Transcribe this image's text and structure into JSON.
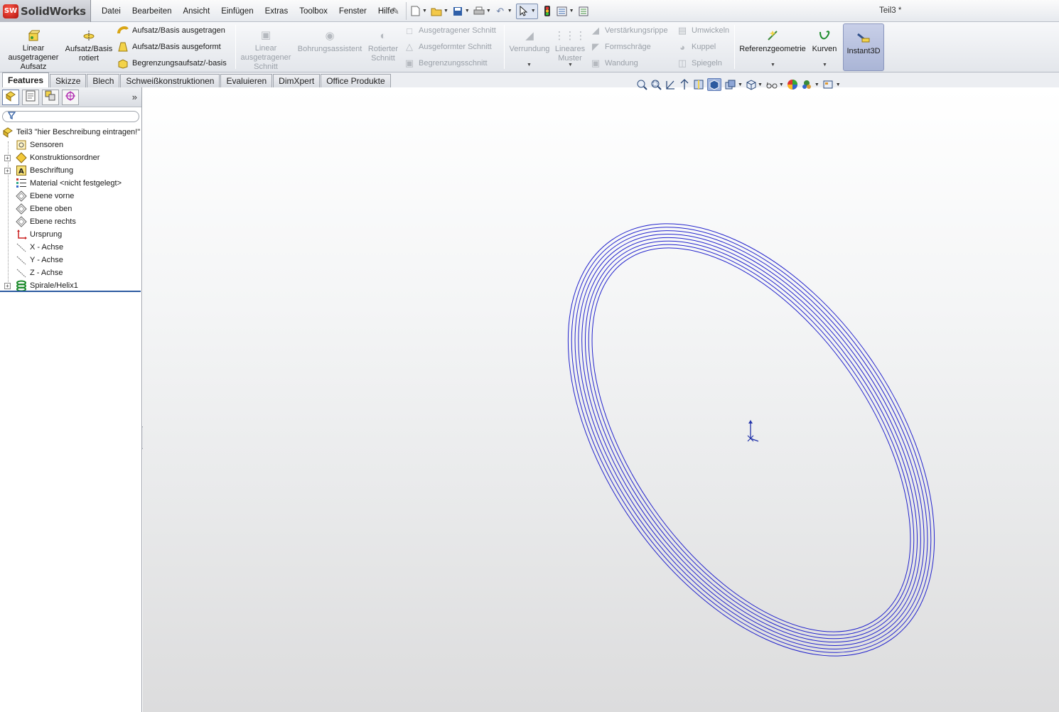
{
  "app": {
    "logo_badge": "SW",
    "name": "SolidWorks",
    "doc_title": "Teil3 *"
  },
  "menu": [
    "Datei",
    "Bearbeiten",
    "Ansicht",
    "Einfügen",
    "Extras",
    "Toolbox",
    "Fenster",
    "Hilfe"
  ],
  "commands": {
    "extrude_boss": "Linear ausgetragener Aufsatz",
    "revolve_boss": "Aufsatz/Basis rotiert",
    "sweep_boss": "Aufsatz/Basis ausgetragen",
    "loft_boss": "Aufsatz/Basis ausgeformt",
    "boundary_boss": "Begrenzungsaufsatz/-basis",
    "extrude_cut": "Linear ausgetragener Schnitt",
    "hole_wizard": "Bohrungsassistent",
    "revolve_cut": "Rotierter Schnitt",
    "sweep_cut": "Ausgetragener Schnitt",
    "loft_cut": "Ausgeformter Schnitt",
    "boundary_cut": "Begrenzungsschnitt",
    "fillet": "Verrundung",
    "linear_pattern": "Lineares Muster",
    "rib": "Verstärkungsrippe",
    "draft": "Formschräge",
    "shell": "Wandung",
    "wrap": "Umwickeln",
    "dome": "Kuppel",
    "mirror": "Spiegeln",
    "ref_geometry": "Referenzgeometrie",
    "curves": "Kurven",
    "instant3d": "Instant3D"
  },
  "tabs": [
    "Features",
    "Skizze",
    "Blech",
    "Schweißkonstruktionen",
    "Evaluieren",
    "DimXpert",
    "Office Produkte"
  ],
  "tree": {
    "root": "Teil3 \"hier Beschreibung eintragen!\"",
    "items": [
      {
        "label": "Sensoren",
        "expandable": false
      },
      {
        "label": "Konstruktionsordner",
        "expandable": true
      },
      {
        "label": "Beschriftung",
        "expandable": true
      },
      {
        "label": "Material <nicht festgelegt>",
        "expandable": false
      },
      {
        "label": "Ebene vorne",
        "expandable": false
      },
      {
        "label": "Ebene oben",
        "expandable": false
      },
      {
        "label": "Ebene rechts",
        "expandable": false
      },
      {
        "label": "Ursprung",
        "expandable": false
      },
      {
        "label": "X - Achse",
        "expandable": false
      },
      {
        "label": "Y - Achse",
        "expandable": false
      },
      {
        "label": "Z - Achse",
        "expandable": false
      },
      {
        "label": "Spirale/Helix1",
        "expandable": true
      }
    ]
  },
  "colors": {
    "helix": "#2222cc",
    "selection": "#2c5aa0",
    "logo_red": "#c81812"
  }
}
